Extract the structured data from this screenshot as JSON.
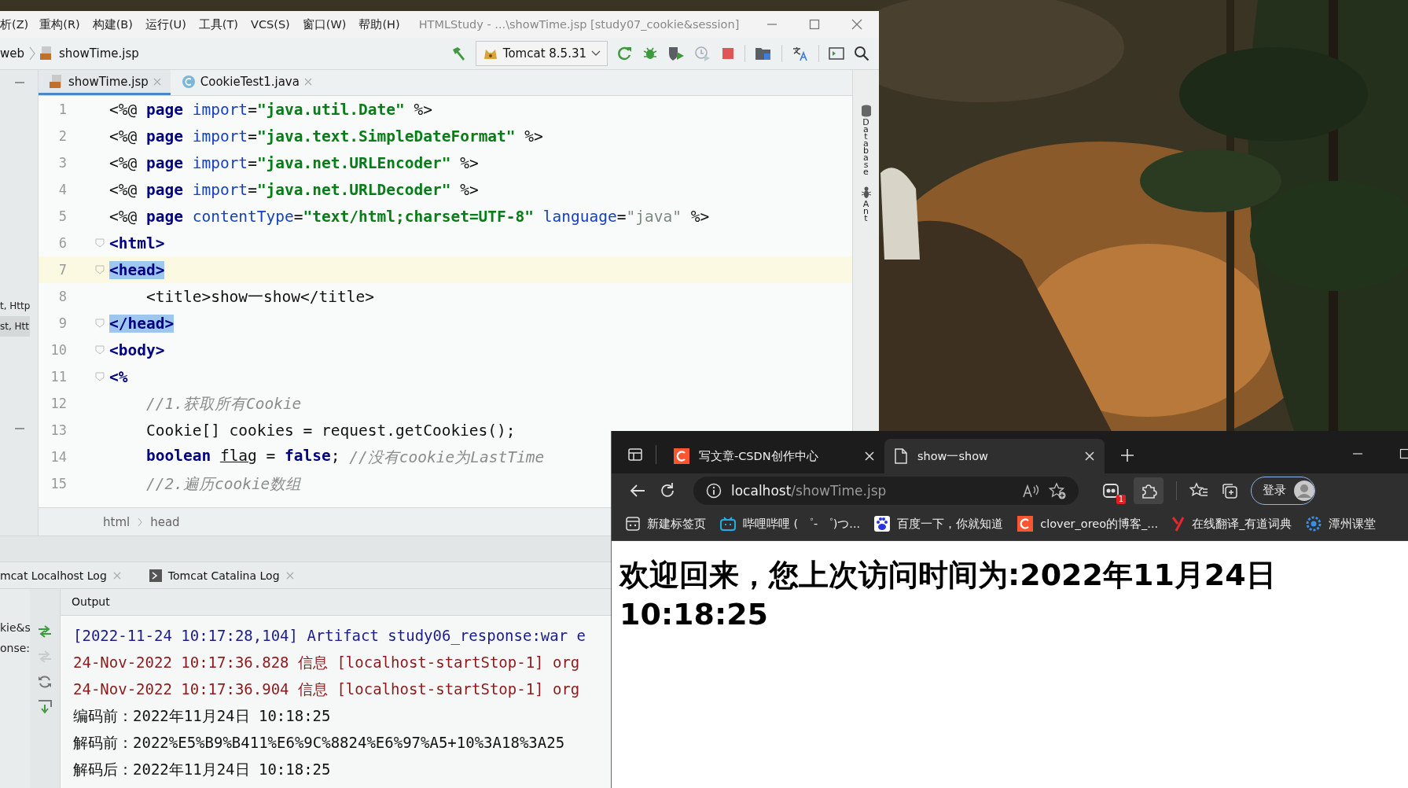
{
  "ide": {
    "menu": [
      "析(Z)",
      "重构(R)",
      "构建(B)",
      "运行(U)",
      "工具(T)",
      "VCS(S)",
      "窗口(W)",
      "帮助(H)"
    ],
    "title": "HTMLStudy - ...\\showTime.jsp [study07_cookie&session]",
    "breadcrumb": [
      "web",
      "showTime.jsp"
    ],
    "run_config": "Tomcat 8.5.31",
    "project_panel": [
      "t, Http",
      "st, Htt"
    ],
    "editor_tabs": [
      {
        "label": "showTime.jsp",
        "selected": true
      },
      {
        "label": "CookieTest1.java",
        "selected": false
      }
    ],
    "code_lines": [
      {
        "number": "1",
        "current": false,
        "fold": false,
        "tokens": [
          {
            "kind": "punct",
            "text": "<%@ "
          },
          {
            "kind": "keyword",
            "text": "page "
          },
          {
            "kind": "attr",
            "text": "import"
          },
          {
            "kind": "punct",
            "text": "="
          },
          {
            "kind": "string",
            "text": "\"java.util.Date\""
          },
          {
            "kind": "punct",
            "text": " %>"
          }
        ]
      },
      {
        "number": "2",
        "current": false,
        "fold": false,
        "tokens": [
          {
            "kind": "punct",
            "text": "<%@ "
          },
          {
            "kind": "keyword",
            "text": "page "
          },
          {
            "kind": "attr",
            "text": "import"
          },
          {
            "kind": "punct",
            "text": "="
          },
          {
            "kind": "string",
            "text": "\"java.text.SimpleDateFormat\""
          },
          {
            "kind": "punct",
            "text": " %>"
          }
        ]
      },
      {
        "number": "3",
        "current": false,
        "fold": false,
        "tokens": [
          {
            "kind": "punct",
            "text": "<%@ "
          },
          {
            "kind": "keyword",
            "text": "page "
          },
          {
            "kind": "attr",
            "text": "import"
          },
          {
            "kind": "punct",
            "text": "="
          },
          {
            "kind": "string",
            "text": "\"java.net.URLEncoder\""
          },
          {
            "kind": "punct",
            "text": " %>"
          }
        ]
      },
      {
        "number": "4",
        "current": false,
        "fold": false,
        "tokens": [
          {
            "kind": "punct",
            "text": "<%@ "
          },
          {
            "kind": "keyword",
            "text": "page "
          },
          {
            "kind": "attr",
            "text": "import"
          },
          {
            "kind": "punct",
            "text": "="
          },
          {
            "kind": "string",
            "text": "\"java.net.URLDecoder\""
          },
          {
            "kind": "punct",
            "text": " %>"
          }
        ]
      },
      {
        "number": "5",
        "current": false,
        "fold": false,
        "tokens": [
          {
            "kind": "punct",
            "text": "<%@ "
          },
          {
            "kind": "keyword",
            "text": "page "
          },
          {
            "kind": "attr",
            "text": "contentType"
          },
          {
            "kind": "punct",
            "text": "="
          },
          {
            "kind": "string",
            "text": "\"text/html;charset=UTF-8\""
          },
          {
            "kind": "attr",
            "text": " language"
          },
          {
            "kind": "punct",
            "text": "="
          },
          {
            "kind": "string-dim",
            "text": "\"java\""
          },
          {
            "kind": "punct",
            "text": " %>"
          }
        ]
      },
      {
        "number": "6",
        "current": false,
        "fold": true,
        "tokens": [
          {
            "kind": "tag",
            "text": "<html>"
          }
        ]
      },
      {
        "number": "7",
        "current": true,
        "fold": true,
        "tokens": [
          {
            "kind": "matched-tag",
            "text": "<head>"
          }
        ]
      },
      {
        "number": "8",
        "current": false,
        "fold": false,
        "tokens": [
          {
            "kind": "plain",
            "text": "    <title>show一show</title>"
          }
        ]
      },
      {
        "number": "9",
        "current": false,
        "fold": true,
        "tokens": [
          {
            "kind": "matched-tag",
            "text": "</head>"
          }
        ]
      },
      {
        "number": "10",
        "current": false,
        "fold": true,
        "tokens": [
          {
            "kind": "tag",
            "text": "<body>"
          }
        ]
      },
      {
        "number": "11",
        "current": false,
        "fold": true,
        "tokens": [
          {
            "kind": "tag",
            "text": "<%"
          }
        ]
      },
      {
        "number": "12",
        "current": false,
        "fold": false,
        "tokens": [
          {
            "kind": "comment",
            "text": "    //1.获取所有Cookie"
          }
        ]
      },
      {
        "number": "13",
        "current": false,
        "fold": false,
        "tokens": [
          {
            "kind": "plain",
            "text": "    Cookie[] cookies = request.getCookies();"
          }
        ]
      },
      {
        "number": "14",
        "current": false,
        "fold": false,
        "tokens": [
          {
            "kind": "keyword",
            "text": "    boolean "
          },
          {
            "kind": "underlined",
            "text": "flag"
          },
          {
            "kind": "plain",
            "text": " = "
          },
          {
            "kind": "keyword",
            "text": "false"
          },
          {
            "kind": "plain",
            "text": "; "
          },
          {
            "kind": "comment",
            "text": "//没有cookie为LastTime"
          }
        ]
      },
      {
        "number": "15",
        "current": false,
        "fold": false,
        "tokens": [
          {
            "kind": "comment",
            "text": "    //2.遍历cookie数组"
          }
        ]
      }
    ],
    "side_tools": [
      "Database",
      "Ant"
    ],
    "path": [
      "html",
      "head"
    ],
    "run_tabs": [
      "mcat Localhost Log",
      "Tomcat Catalina Log"
    ],
    "run_panel": [
      "kie&s",
      "onse:"
    ],
    "output_label": "Output",
    "log": [
      {
        "kind": "system",
        "text": "[2022-11-24 10:17:28,104] Artifact study06_response:war e"
      },
      {
        "kind": "info",
        "text": "24-Nov-2022 10:17:36.828 信息 [localhost-startStop-1] org"
      },
      {
        "kind": "info",
        "text": "24-Nov-2022 10:17:36.904 信息 [localhost-startStop-1] org"
      },
      {
        "kind": "stdout",
        "text": "编码前：2022年11月24日 10:18:25"
      },
      {
        "kind": "stdout",
        "text": "解码前：2022%E5%B9%B411%E6%9C%8824%E6%97%A5+10%3A18%3A25"
      },
      {
        "kind": "stdout",
        "text": "解码后：2022年11月24日 10:18:25"
      }
    ]
  },
  "browser": {
    "tabs": [
      {
        "title": "写文章-CSDN创作中心",
        "selected": false
      },
      {
        "title": "show一show",
        "selected": true
      }
    ],
    "url_host": "localhost",
    "url_path": "/showTime.jsp",
    "extension_badge": "1",
    "signin": "登录",
    "bookmarks": [
      {
        "label": "新建标签页"
      },
      {
        "label": "哔哩哔哩 ( ゜- ゜)つ..."
      },
      {
        "label": "百度一下，你就知道"
      },
      {
        "label": "clover_oreo的博客_..."
      },
      {
        "label": "在线翻译_有道词典"
      },
      {
        "label": "潭州课堂"
      }
    ],
    "heading": "欢迎回来，您上次访问时间为:2022年11月24日 10:18:25"
  }
}
